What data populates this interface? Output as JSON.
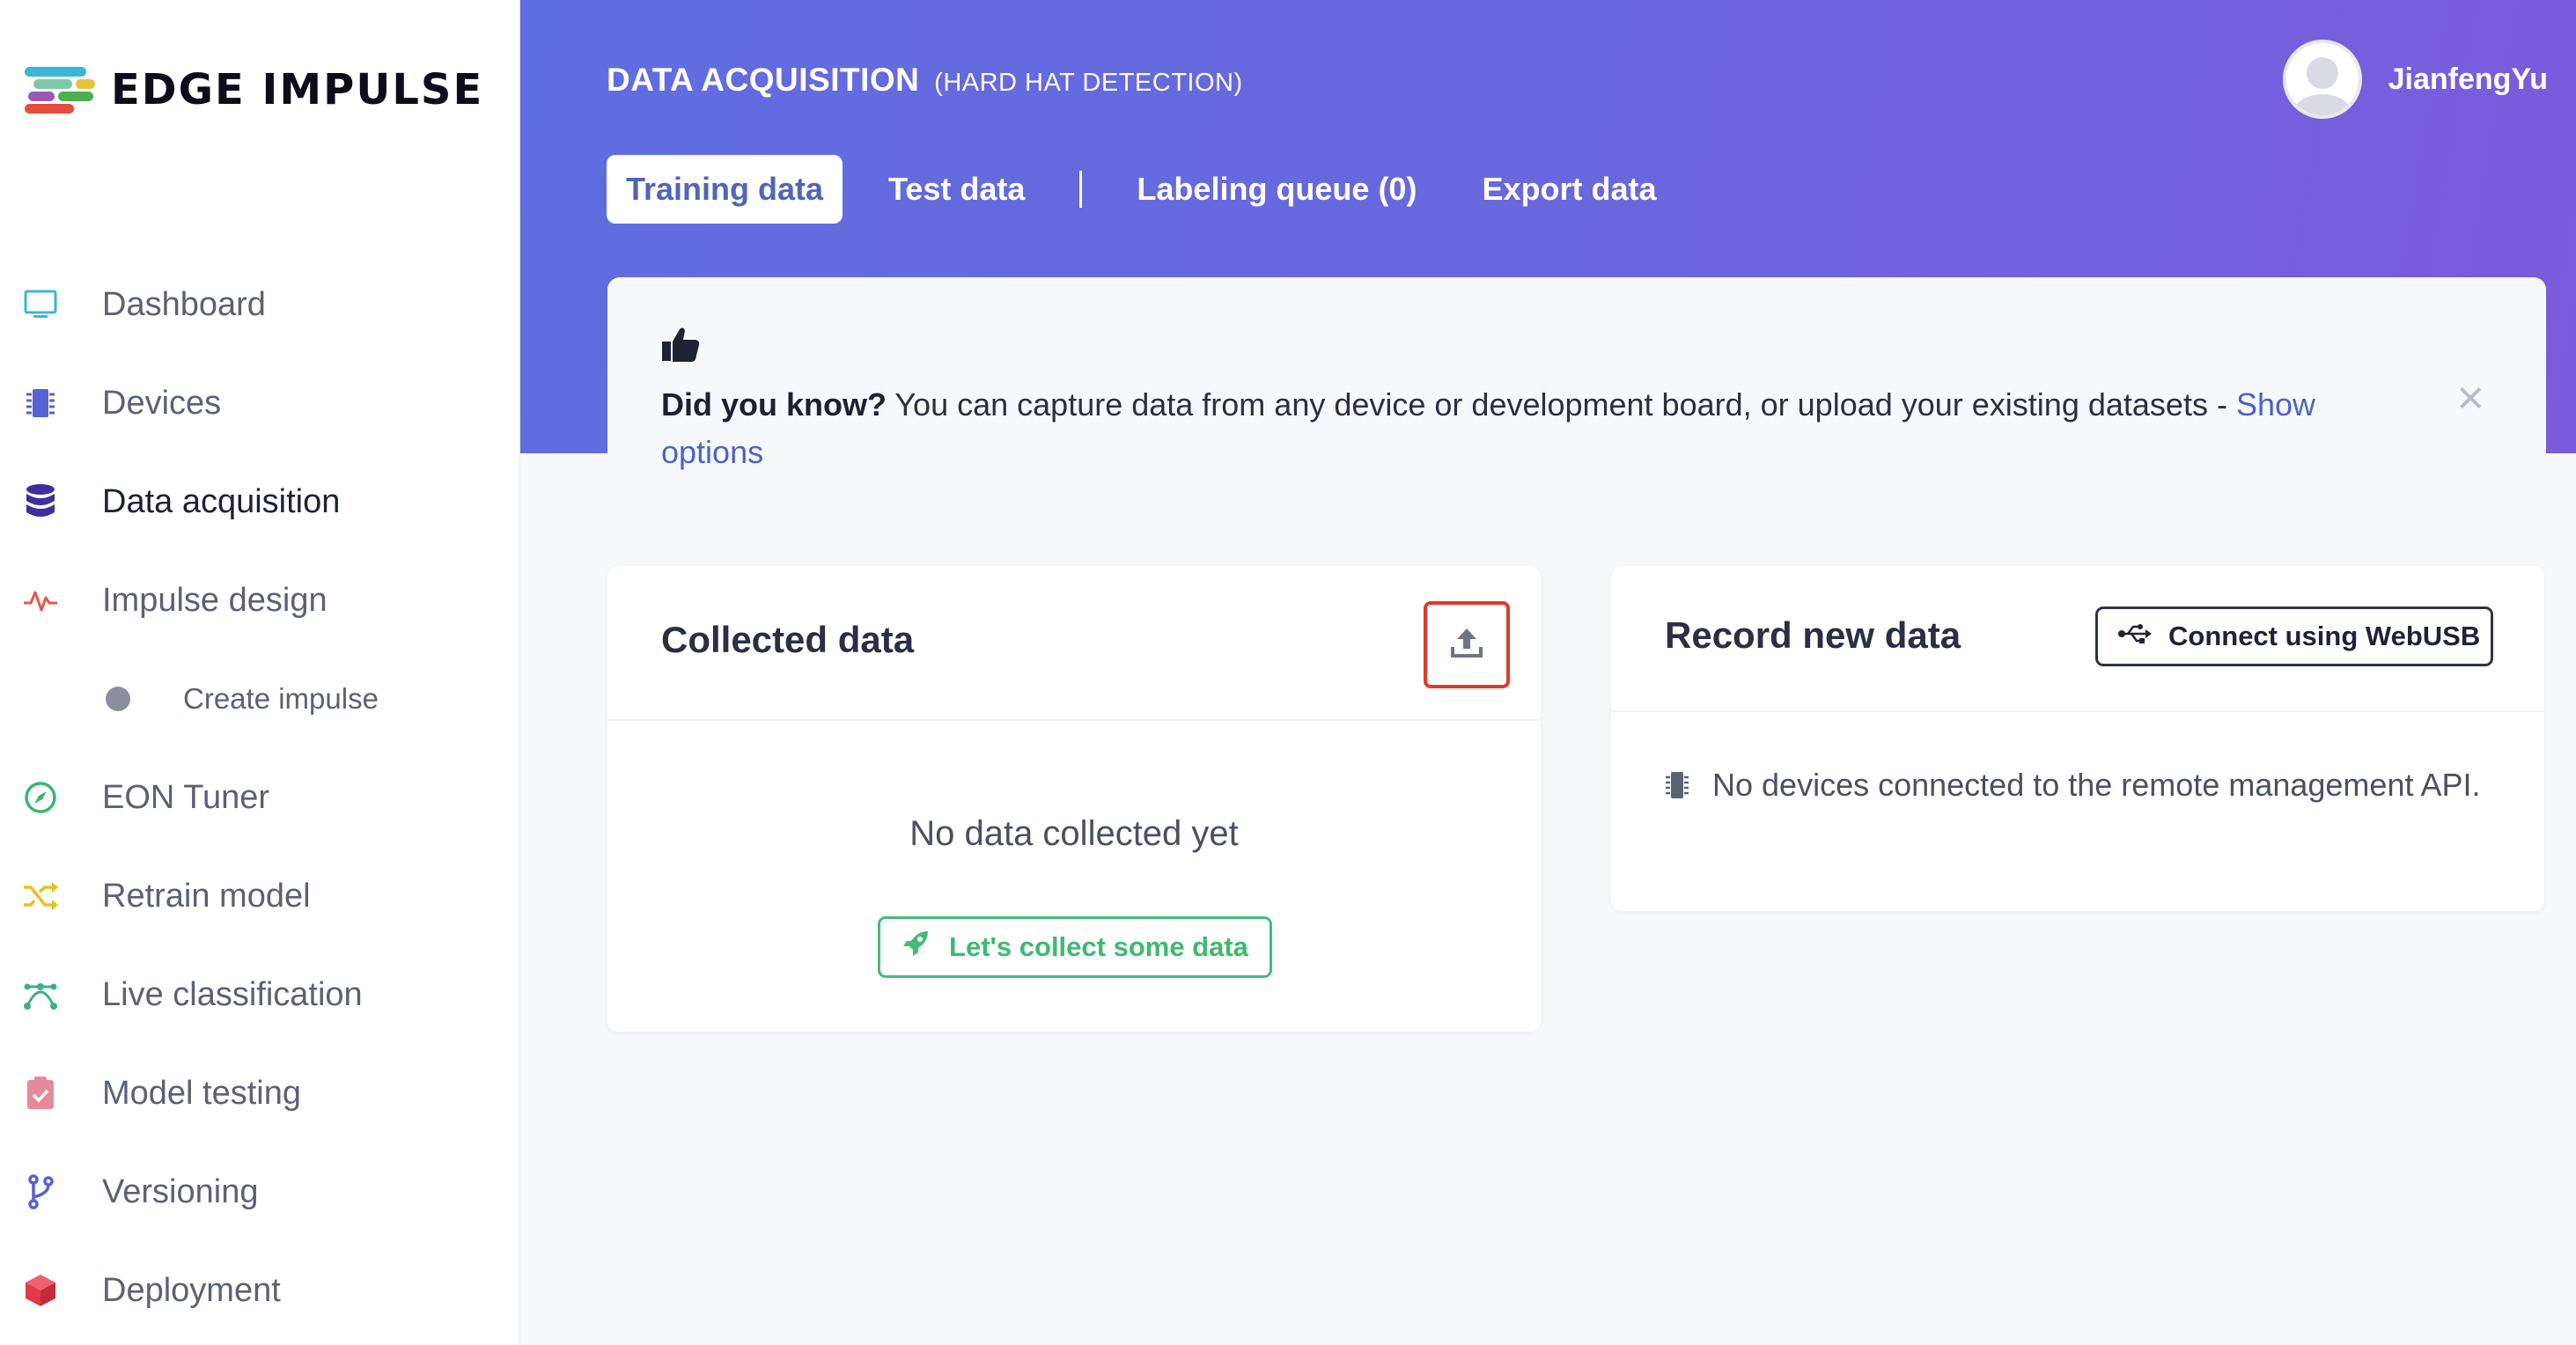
{
  "app": {
    "logo_text": "EDGE IMPULSE",
    "brand_colors": [
      "#3bb7d6",
      "#e5c43a",
      "#9b59b6",
      "#e74c3c",
      "#4caf50"
    ]
  },
  "sidebar": {
    "items": [
      {
        "label": "Dashboard",
        "icon": "monitor-icon",
        "color": "#3bb7d6"
      },
      {
        "label": "Devices",
        "icon": "chip-icon",
        "color": "#5562d6"
      },
      {
        "label": "Data acquisition",
        "icon": "database-icon",
        "color": "#3f2f9e",
        "active": true
      },
      {
        "label": "Impulse design",
        "icon": "pulse-icon",
        "color": "#e05a4a"
      },
      {
        "label": "Create impulse",
        "icon": "dot-icon",
        "color": "#8a8fa0",
        "sub": true
      },
      {
        "label": "EON Tuner",
        "icon": "compass-icon",
        "color": "#37b86a"
      },
      {
        "label": "Retrain model",
        "icon": "shuffle-icon",
        "color": "#e8c21e"
      },
      {
        "label": "Live classification",
        "icon": "network-icon",
        "color": "#3fae8a"
      },
      {
        "label": "Model testing",
        "icon": "clipboard-check-icon",
        "color": "#e58a9a"
      },
      {
        "label": "Versioning",
        "icon": "git-branch-icon",
        "color": "#5562d6"
      },
      {
        "label": "Deployment",
        "icon": "cube-icon",
        "color": "#e0394b"
      }
    ]
  },
  "header": {
    "title": "DATA ACQUISITION",
    "subtitle": "(HARD HAT DETECTION)",
    "user": "JianfengYu",
    "tabs": [
      {
        "label": "Training data",
        "active": true
      },
      {
        "label": "Test data"
      },
      {
        "label": "Labeling queue (0)"
      },
      {
        "label": "Export data"
      }
    ]
  },
  "tip": {
    "icon": "thumbs-up-icon",
    "bold": "Did you know?",
    "text": " You can capture data from any device or development board, or upload your existing datasets - ",
    "link": "Show options",
    "close": "×"
  },
  "collected": {
    "title": "Collected data",
    "upload_icon": "upload-icon",
    "empty": "No data collected yet",
    "button": "Let's collect some data"
  },
  "record": {
    "title": "Record new data",
    "button": "Connect using WebUSB",
    "message": "No devices connected to the remote management API."
  }
}
